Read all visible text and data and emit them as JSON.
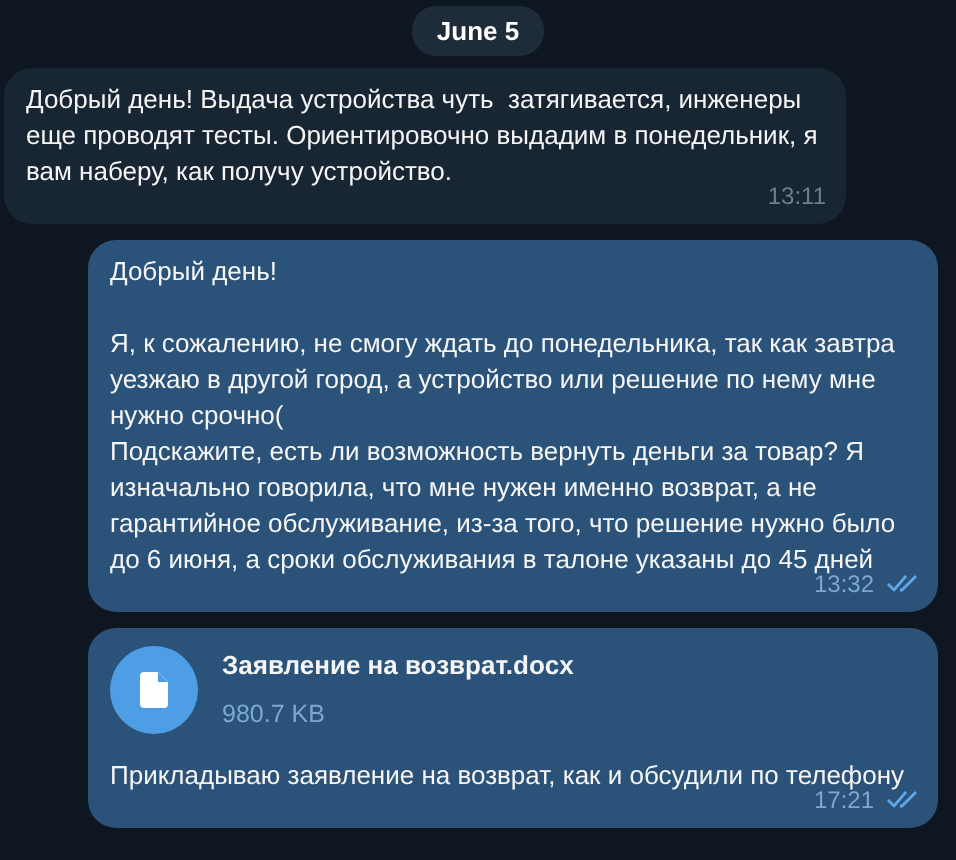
{
  "date_badge": "June 5",
  "messages": [
    {
      "kind": "text",
      "outgoing": false,
      "text": "Добрый день! Выдача устройства чуть  затягивается, инженеры еще проводят тесты. Ориентировочно выдадим в понедельник, я вам наберу, как получу устройство.",
      "time": "13:11"
    },
    {
      "kind": "text",
      "outgoing": true,
      "read": true,
      "text": "Добрый день!\n\nЯ, к сожалению, не смогу ждать до понедельника, так как завтра уезжаю в другой город, а устройство или решение по нему мне нужно срочно(\nПодскажите, есть ли возможность вернуть деньги за товар? Я изначально говорила, что мне нужен именно возврат, а не гарантийное обслуживание, из-за того, что решение нужно было до 6 июня, а сроки обслуживания в талоне указаны до 45 дней",
      "time": "13:32"
    },
    {
      "kind": "file",
      "outgoing": true,
      "read": true,
      "file_name": "Заявление на возврат.docx",
      "file_size": "980.7 KB",
      "text": "Прикладываю заявление на возврат, как и обсудили по телефону",
      "time": "17:21"
    }
  ]
}
